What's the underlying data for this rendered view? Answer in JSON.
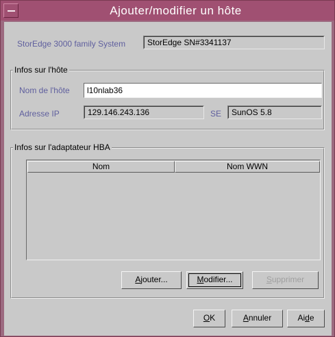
{
  "window": {
    "title": "Ajouter/modifier un hôte"
  },
  "system": {
    "label": "StorEdge 3000 family System",
    "value": "StorEdge SN#3341137"
  },
  "host_group": {
    "legend": "Infos sur l'hôte",
    "host_name_label": "Nom de l'hôte",
    "host_name_value": "l10nlab36",
    "ip_label": "Adresse IP",
    "ip_value": "129.146.243.136",
    "os_label": "SE",
    "os_value": "SunOS 5.8"
  },
  "hba_group": {
    "legend": "Infos sur l'adaptateur HBA",
    "columns": [
      "Nom",
      "Nom WWN"
    ],
    "rows": [],
    "buttons": {
      "add": {
        "pre": "",
        "mn": "A",
        "post": "jouter..."
      },
      "modify": {
        "pre": "",
        "mn": "M",
        "post": "odifier..."
      },
      "delete": {
        "pre": "",
        "mn": "S",
        "post": "upprimer"
      }
    }
  },
  "footer": {
    "ok": {
      "pre": "",
      "mn": "O",
      "post": "K"
    },
    "cancel": {
      "pre": "",
      "mn": "A",
      "post": "nnuler"
    },
    "help": {
      "pre": "Ai",
      "mn": "d",
      "post": "e"
    }
  }
}
